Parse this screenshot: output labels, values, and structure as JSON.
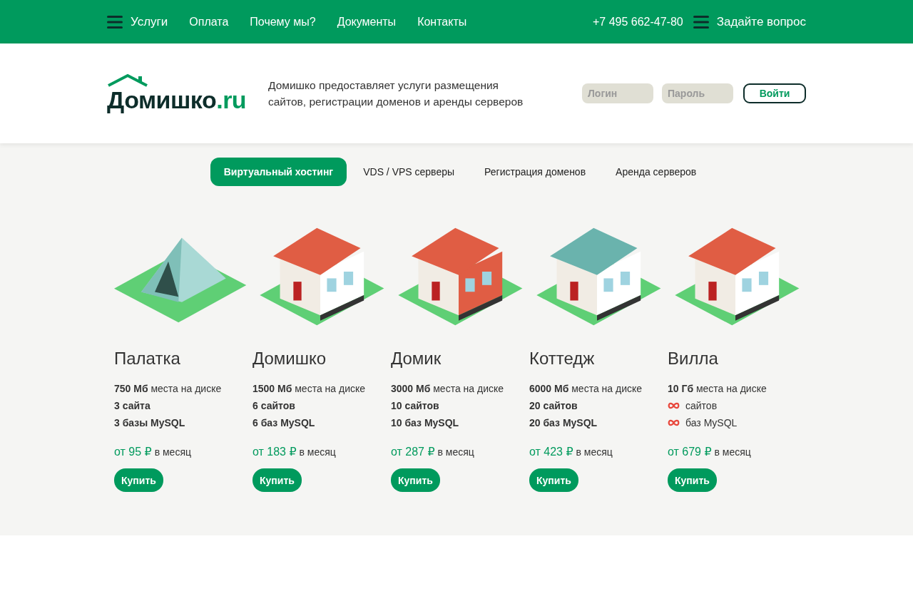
{
  "topbar": {
    "menu": [
      {
        "label": "Услуги",
        "kind": "menu"
      },
      {
        "label": "Оплата",
        "kind": "link"
      },
      {
        "label": "Почему мы?",
        "kind": "link"
      },
      {
        "label": "Документы",
        "kind": "link"
      },
      {
        "label": "Контакты",
        "kind": "link"
      }
    ],
    "phone": "+7 495 662-47-80",
    "ask": "Задайте вопрос"
  },
  "header": {
    "logo": {
      "name": "Домишко",
      "tld": ".ru"
    },
    "tagline": "Домишко предоставляет услуги размещения сайтов, регистрации доменов и аренды серверов",
    "login": {
      "placeholder": "Логин"
    },
    "password": {
      "placeholder": "Пароль"
    },
    "submit": "Войти"
  },
  "tabs": [
    {
      "label": "Виртуальный хостинг",
      "selected": true
    },
    {
      "label": "VDS / VPS серверы",
      "selected": false
    },
    {
      "label": "Регистрация доменов",
      "selected": false
    },
    {
      "label": "Аренда серверов",
      "selected": false
    }
  ],
  "plans": [
    {
      "kind": "tent",
      "name": "Палатка",
      "features": [
        {
          "kind": "mixed",
          "text": "**750 Мб** места на диске"
        },
        {
          "kind": "value",
          "text": "3 сайта"
        },
        {
          "kind": "value",
          "text": "3 базы MySQL"
        }
      ],
      "price": "от 95 ₽",
      "period": "в месяц",
      "button": "Купить"
    },
    {
      "kind": "house",
      "name": "Домишко",
      "features": [
        {
          "kind": "mixed",
          "text": "**1500 Мб** места на диске"
        },
        {
          "kind": "value",
          "text": "6 сайтов"
        },
        {
          "kind": "value",
          "text": "6 баз MySQL"
        }
      ],
      "price": "от 183 ₽",
      "period": "в месяц",
      "button": "Купить"
    },
    {
      "kind": "townhouse",
      "name": "Домик",
      "features": [
        {
          "kind": "mixed",
          "text": "**3000 Мб** места на диске"
        },
        {
          "kind": "value",
          "text": "10 сайтов"
        },
        {
          "kind": "value",
          "text": "10 баз MySQL"
        }
      ],
      "price": "от 287 ₽",
      "period": "в месяц",
      "button": "Купить"
    },
    {
      "kind": "cottage",
      "name": "Коттедж",
      "features": [
        {
          "kind": "mixed",
          "text": "**6000 Мб** места на диске"
        },
        {
          "kind": "value",
          "text": "20 сайтов"
        },
        {
          "kind": "value",
          "text": "20 баз MySQL"
        }
      ],
      "price": "от 423 ₽",
      "period": "в месяц",
      "button": "Купить"
    },
    {
      "kind": "villa",
      "name": "Вилла",
      "features": [
        {
          "kind": "mixed",
          "text": "**10 Гб** места на диске"
        },
        {
          "kind": "unlimited",
          "text": "сайтов"
        },
        {
          "kind": "unlimited",
          "text": "баз MySQL"
        }
      ],
      "price": "от 679 ₽",
      "period": "в месяц",
      "button": "Купить"
    }
  ]
}
